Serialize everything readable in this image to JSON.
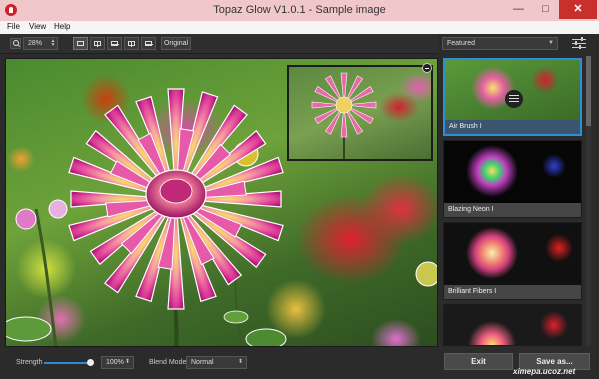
{
  "window": {
    "title": "Topaz Glow V1.0.1 - Sample image",
    "min_glyph": "—",
    "max_glyph": "□",
    "close_glyph": "✕"
  },
  "menu": [
    "File",
    "View",
    "Help"
  ],
  "toolbar": {
    "zoom_value": "28%",
    "original_label": "Original"
  },
  "panel": {
    "preset_category": "Featured",
    "presets": [
      {
        "label": "Air Brush I",
        "selected": true
      },
      {
        "label": "Blazing Neon I",
        "selected": false
      },
      {
        "label": "Brilliant Fibers I",
        "selected": false
      },
      {
        "label": "",
        "selected": false
      }
    ]
  },
  "bottom": {
    "strength_label": "Strength",
    "strength_value": "100%",
    "strength_level": 1.0,
    "blend_mode_label": "Blend Mode",
    "blend_mode_value": "Normal"
  },
  "actions": {
    "exit_label": "Exit",
    "save_label": "Save as..."
  },
  "watermark": "ximepa.ucoz.net",
  "colors": {
    "accent": "#2e8ed8",
    "close_button": "#c7302c",
    "titlebar": "#f0c8cc"
  }
}
